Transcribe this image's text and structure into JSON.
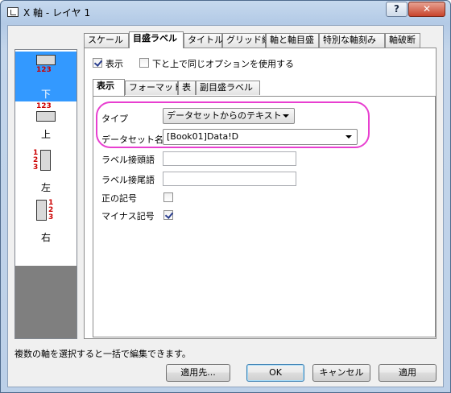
{
  "window": {
    "title": "X 軸 - レイヤ 1",
    "help": "?",
    "close": "✕"
  },
  "axes": [
    {
      "label": "下",
      "nums": "123"
    },
    {
      "label": "上",
      "nums": "123"
    },
    {
      "label": "左",
      "nums": "123"
    },
    {
      "label": "右",
      "nums": "123"
    }
  ],
  "tabs": [
    "スケール",
    "目盛ラベル",
    "タイトル",
    "グリッド線",
    "軸と軸目盛",
    "特別な軸刻み",
    "軸破断"
  ],
  "panel": {
    "show_label": "表示",
    "same_option_label": "下と上で同じオプションを使用する",
    "subtabs": [
      "表示",
      "フォーマット",
      "表",
      "副目盛ラベル"
    ],
    "type_label": "タイプ",
    "type_value": "データセットからのテキスト",
    "dataset_label": "データセット名",
    "dataset_value": "[Book01]Data!D",
    "prefix_label": "ラベル接頭語",
    "suffix_label": "ラベル接尾語",
    "plus_label": "正の記号",
    "minus_label": "マイナス記号"
  },
  "status_text": "複数の軸を選択すると一括で編集できます。",
  "buttons": {
    "apply_to": "適用先...",
    "ok": "OK",
    "cancel": "キャンセル",
    "apply": "適用"
  }
}
